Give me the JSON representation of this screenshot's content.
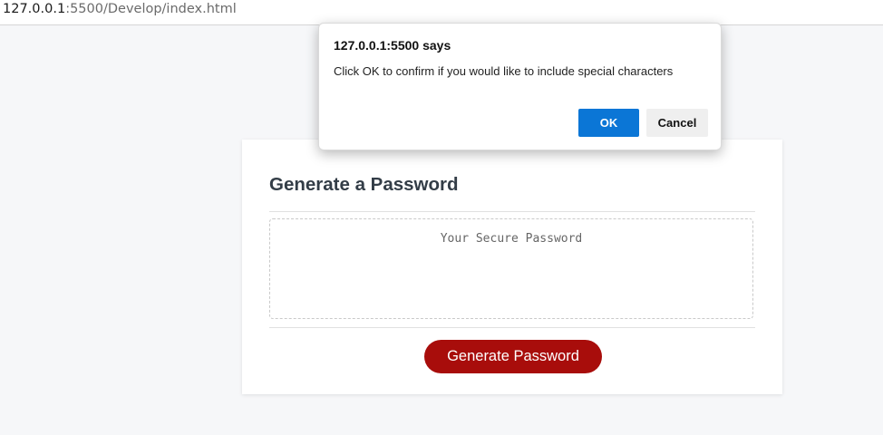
{
  "browser": {
    "url_host": "127.0.0.1",
    "url_path": ":5500/Develop/index.html"
  },
  "card": {
    "title": "Generate a Password",
    "password_placeholder": "Your Secure Password",
    "password_value": "",
    "generate_label": "Generate Password"
  },
  "dialog": {
    "title": "127.0.0.1:5500 says",
    "message": "Click OK to confirm if you would like to include special characters",
    "ok_label": "OK",
    "cancel_label": "Cancel"
  },
  "colors": {
    "generate_button": "#a80d0b",
    "ok_button": "#0b76d6",
    "title_text": "#333d47"
  }
}
